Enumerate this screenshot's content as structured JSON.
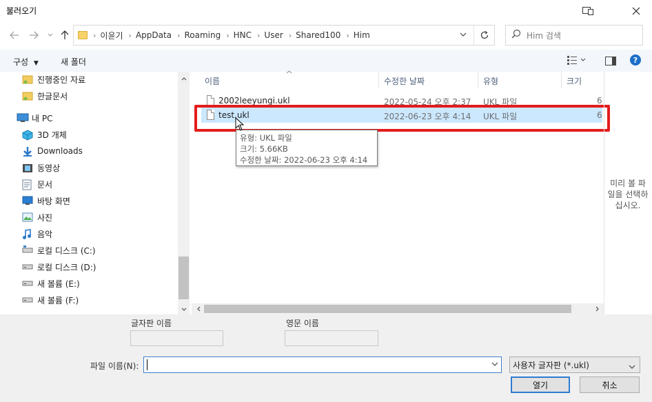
{
  "window": {
    "title": "불러오기",
    "preview_toggle_icon": "preview-pane-icon",
    "close_icon": "close-icon"
  },
  "address": {
    "crumbs": [
      "이윤기",
      "AppData",
      "Roaming",
      "HNC",
      "User",
      "Shared100",
      "Him"
    ],
    "search_placeholder": "Him 검색"
  },
  "toolbar": {
    "organize": "구성",
    "new_folder": "새 폴더"
  },
  "nav": {
    "items": [
      {
        "label": "진행중인 자료",
        "icon": "folder-pin-icon"
      },
      {
        "label": "한글문서",
        "icon": "folder-pin-icon"
      },
      {
        "label": "내 PC",
        "icon": "computer-icon"
      },
      {
        "label": "3D 개체",
        "icon": "cube-3d-icon"
      },
      {
        "label": "Downloads",
        "icon": "download-icon"
      },
      {
        "label": "동영상",
        "icon": "video-icon"
      },
      {
        "label": "문서",
        "icon": "document-icon"
      },
      {
        "label": "바탕 화면",
        "icon": "desktop-icon"
      },
      {
        "label": "사진",
        "icon": "picture-icon"
      },
      {
        "label": "음악",
        "icon": "music-icon"
      },
      {
        "label": "로컬 디스크 (C:)",
        "icon": "drive-icon"
      },
      {
        "label": "로컬 디스크 (D:)",
        "icon": "drive-icon"
      },
      {
        "label": "새 볼륨 (E:)",
        "icon": "drive-icon"
      },
      {
        "label": "새 볼륨 (F:)",
        "icon": "drive-icon"
      }
    ]
  },
  "files": {
    "columns": [
      "이름",
      "수정한 날짜",
      "유형",
      "크기"
    ],
    "rows": [
      {
        "name": "2002leeyungi.ukl",
        "date": "2022-05-24 오후 2:37",
        "type": "UKL 파일",
        "size": "6"
      },
      {
        "name": "test.ukl",
        "date": "2022-06-23 오후 4:14",
        "type": "UKL 파일",
        "size": "6"
      }
    ],
    "tooltip": [
      "유형: UKL 파일",
      "크기: 5.66KB",
      "수정한 날짜: 2022-06-23 오후 4:14"
    ]
  },
  "preview": {
    "text_lines": [
      "미리 볼 파",
      "일을 선택하",
      "십시오."
    ]
  },
  "bottom": {
    "font_name_label": "글자판 이름",
    "english_name_label": "영문 이름",
    "filename_label": "파일 이름(N):",
    "filename_value": "",
    "filter_value": "사용자 글자판 (*.ukl)",
    "open_button": "열기",
    "cancel_button": "취소"
  },
  "colors": {
    "selection": "#cce8ff",
    "highlight_box": "#e31c1c",
    "accent": "#2e7bd1"
  }
}
